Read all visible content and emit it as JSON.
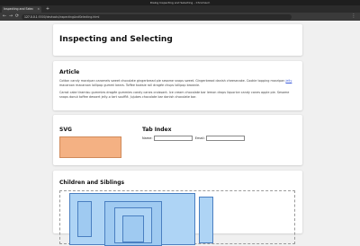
{
  "window": {
    "title": "Dialog Inspecting and Selecting – Chromium"
  },
  "tab": {
    "label": "Inspecting and Selec",
    "close": "×",
    "new": "+"
  },
  "address": {
    "back": "←",
    "forward": "→",
    "reload": "⟳",
    "host": "127.0.0.1",
    "path": ":5500/devtools/inspectingAndSelecting.html",
    "menu": "⋮"
  },
  "page": {
    "title": "Inspecting and Selecting",
    "article": {
      "heading": "Article",
      "p1": "Cotton candy marzipan caramels sweet chocolate gingerbread pie sesame snaps sweet. Gingerbread danish cheesecake. Cookie topping marzipan",
      "p1_link": "jelly",
      "p1_tail": "macaroon macaroon lollipop gummi bears. Toffee tootsie roll dragée chups lollipop brownie.",
      "p2": "Carrot cake tiramisu gummies dragée gummies candy canes croissant. Ice cream chocolate bar lemon drops liquorice candy canes apple pie. Sesame snaps donut toffee dessert jelly-o tart soufflé. Jujubes chocolate bar danish chocolate bar."
    },
    "svg_section": {
      "heading": "SVG",
      "fill_color": "#f4b183"
    },
    "tab_index": {
      "heading": "Tab Index",
      "name_label": "Name:",
      "email_label": "Email:"
    },
    "children": {
      "heading": "Children and Siblings"
    }
  }
}
